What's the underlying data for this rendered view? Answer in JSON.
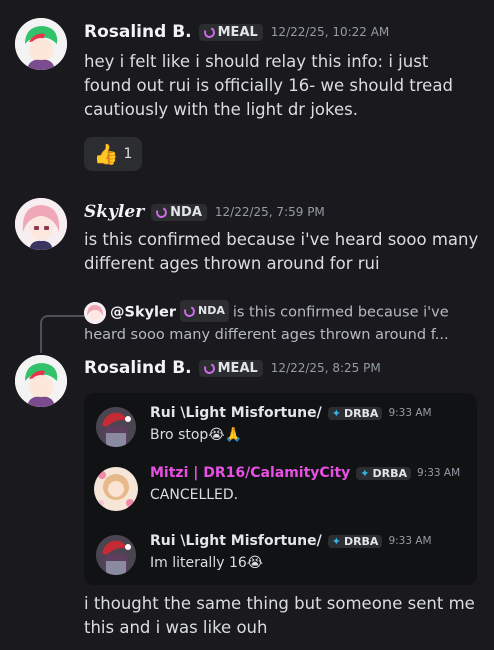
{
  "messages": {
    "m1": {
      "username": "Rosalind B.",
      "tag": "MEAL",
      "timestamp": "12/22/25, 10:22 AM",
      "text": "hey i felt like i should relay this info: i just found out rui is officially 16- we should tread cautiously with the light dr jokes.",
      "reaction": {
        "emoji": "👍",
        "count": "1"
      }
    },
    "m2": {
      "username": "Skyler",
      "tag": "NDA",
      "timestamp": "12/22/25, 7:59 PM",
      "text": "is this confirmed because i've heard sooo many different ages thrown around for rui"
    },
    "reply": {
      "username": "@Skyler",
      "tag": "NDA",
      "text": "is this confirmed because i've heard sooo many different ages thrown around f..."
    },
    "m3": {
      "username": "Rosalind B.",
      "tag": "MEAL",
      "timestamp": "12/22/25, 8:25 PM",
      "text": "i thought the same thing but someone sent me this and i was like ouh"
    }
  },
  "embed": {
    "rows": [
      {
        "username": "Rui \\Light Misfortune/",
        "tag": "DRBA",
        "timestamp": "9:33 AM",
        "text": "Bro stop😭🙏"
      },
      {
        "username": "Mitzi | DR16/CalamityCity",
        "tag": "DRBA",
        "timestamp": "9:33 AM",
        "text": "CANCELLED."
      },
      {
        "username": "Rui \\Light Misfortune/",
        "tag": "DRBA",
        "timestamp": "9:33 AM",
        "text": "Im literally 16😭"
      }
    ]
  },
  "colors": {
    "background": "#1a1a1e",
    "tag_icon": "#d16ae8",
    "mitzi_name": "#e84fe3",
    "drba_feather": "#34b3e8"
  },
  "icons": [
    "user-avatar-icon",
    "guild-tag-icon",
    "thumbs-up-emoji",
    "feather-icon"
  ]
}
